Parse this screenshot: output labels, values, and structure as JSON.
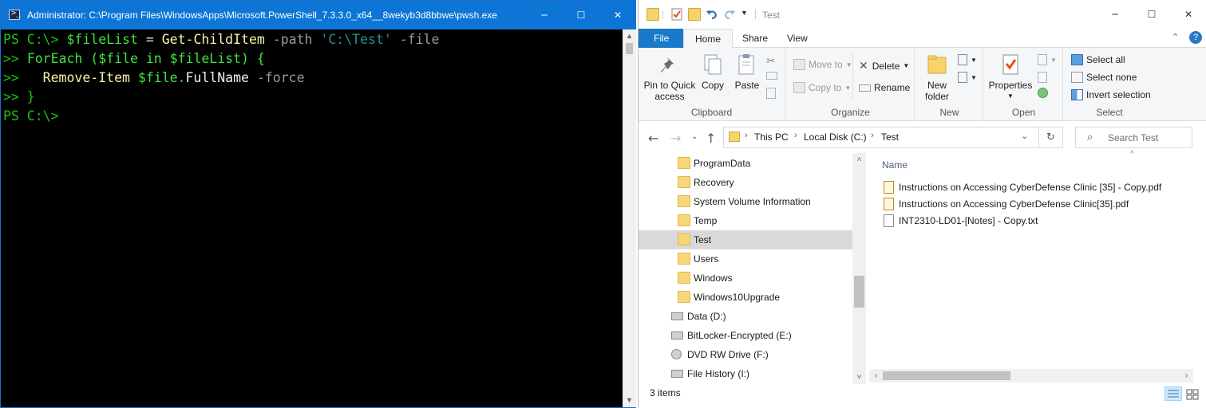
{
  "colors": {
    "ps_title_bar": "#0c75d6",
    "ps_background": "#000000",
    "explorer_accent": "#1979ca",
    "selected_item": "#d9d9d9"
  },
  "powershell": {
    "title": "Administrator: C:\\Program Files\\WindowsApps\\Microsoft.PowerShell_7.3.3.0_x64__8wekyb3d8bbwe\\pwsh.exe",
    "icon": "powershell-icon",
    "buttons": {
      "minimize": "─",
      "maximize": "☐",
      "close": "✕"
    },
    "lines": [
      [
        {
          "text": "PS C:\\> ",
          "cls": "c-prompt"
        },
        {
          "text": "$fileList",
          "cls": "c-var"
        },
        {
          "text": " = ",
          "cls": "c-op"
        },
        {
          "text": "Get-ChildItem",
          "cls": "c-cmd"
        },
        {
          "text": " -path",
          "cls": "c-param"
        },
        {
          "text": " 'C:\\Test'",
          "cls": "c-str"
        },
        {
          "text": " -file",
          "cls": "c-param"
        }
      ],
      [
        {
          "text": ">> ",
          "cls": "c-prompt"
        },
        {
          "text": "ForEach (",
          "cls": "c-green"
        },
        {
          "text": "$file",
          "cls": "c-var"
        },
        {
          "text": " in ",
          "cls": "c-green"
        },
        {
          "text": "$fileList",
          "cls": "c-var"
        },
        {
          "text": ") {",
          "cls": "c-green"
        }
      ],
      [
        {
          "text": ">>   ",
          "cls": "c-prompt"
        },
        {
          "text": "Remove-Item",
          "cls": "c-cmd"
        },
        {
          "text": " $file.",
          "cls": "c-var"
        },
        {
          "text": "FullName",
          "cls": "c-plain"
        },
        {
          "text": " -force",
          "cls": "c-param"
        }
      ],
      [
        {
          "text": ">> }",
          "cls": "c-prompt"
        }
      ],
      [
        {
          "text": "PS C:\\>",
          "cls": "c-prompt"
        }
      ]
    ]
  },
  "explorer": {
    "title": "Test",
    "buttons": {
      "minimize": "─",
      "maximize": "☐",
      "close": "✕"
    },
    "tabs": [
      {
        "label": "File"
      },
      {
        "label": "Home"
      },
      {
        "label": "Share"
      },
      {
        "label": "View"
      }
    ],
    "ribbon": {
      "clipboard": {
        "label": "Clipboard",
        "pin": "Pin to Quick\naccess",
        "copy": "Copy",
        "paste": "Paste"
      },
      "organize": {
        "label": "Organize",
        "move_to": "Move to",
        "copy_to": "Copy to",
        "delete": "Delete",
        "rename": "Rename"
      },
      "new": {
        "label": "New",
        "new_folder": "New\nfolder"
      },
      "open": {
        "label": "Open",
        "properties": "Properties"
      },
      "select": {
        "label": "Select",
        "select_all": "Select all",
        "select_none": "Select none",
        "invert": "Invert selection"
      }
    },
    "address": {
      "crumbs": [
        "This PC",
        "Local Disk (C:)",
        "Test"
      ]
    },
    "search": {
      "placeholder": "Search Test"
    },
    "nav_items": [
      {
        "label": "ProgramData",
        "type": "folder",
        "selected": false
      },
      {
        "label": "Recovery",
        "type": "folder",
        "selected": false
      },
      {
        "label": "System Volume Information",
        "type": "folder",
        "selected": false
      },
      {
        "label": "Temp",
        "type": "folder",
        "selected": false
      },
      {
        "label": "Test",
        "type": "folder",
        "selected": true
      },
      {
        "label": "Users",
        "type": "folder",
        "selected": false
      },
      {
        "label": "Windows",
        "type": "folder",
        "selected": false
      },
      {
        "label": "Windows10Upgrade",
        "type": "folder",
        "selected": false
      },
      {
        "label": "Data (D:)",
        "type": "drive",
        "selected": false
      },
      {
        "label": "BitLocker-Encrypted (E:)",
        "type": "drive",
        "selected": false
      },
      {
        "label": "DVD RW Drive (F:)",
        "type": "dvd",
        "selected": false
      },
      {
        "label": "File History (I:)",
        "type": "drive",
        "selected": false
      }
    ],
    "column_header": "Name",
    "files": [
      {
        "name": "Instructions on Accessing CyberDefense Clinic [35] - Copy.pdf",
        "type": "pdf"
      },
      {
        "name": "Instructions on Accessing CyberDefense Clinic[35].pdf",
        "type": "pdf"
      },
      {
        "name": "INT2310-LD01-[Notes] - Copy.txt",
        "type": "txt"
      }
    ],
    "status": {
      "count": "3 items"
    }
  }
}
